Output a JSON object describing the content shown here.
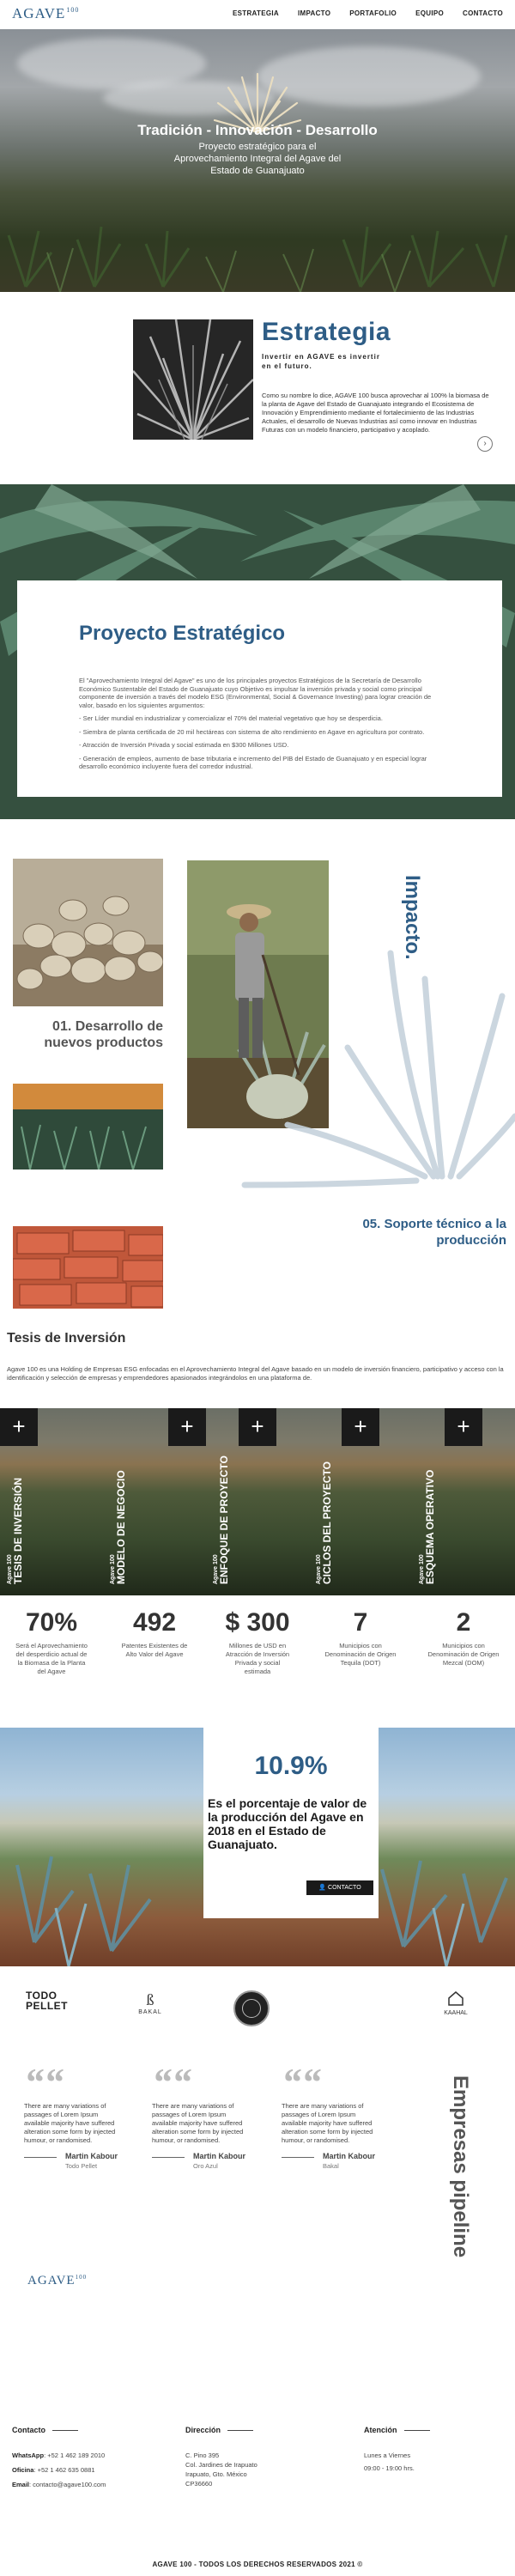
{
  "header": {
    "logo": "AGAVE",
    "logo_num": "100",
    "nav": [
      "ESTRATEGIA",
      "IMPACTO",
      "PORTAFOLIO",
      "EQUIPO",
      "CONTACTO"
    ]
  },
  "hero": {
    "title": "Tradición - Innovación - Desarrollo",
    "subtitle": "Proyecto estratégico para el Aprovechamiento Integral del Agave del Estado de Guanajuato"
  },
  "estrategia": {
    "title": "Estrategia",
    "tagline": "Invertir en AGAVE es invertir en el futuro.",
    "body": "Como su nombre lo dice, AGAVE 100 busca aprovechar al 100% la biomasa de la planta de Agave del Estado de Guanajuato integrando el Ecosistema de Innovación y Emprendimiento mediante el fortalecimiento de las Industrias Actuales, el desarrollo de Nuevas Industrias así como innovar en Industrias Futuras con un modelo financiero, participativo y acoplado.",
    "next_glyph": "›"
  },
  "proyecto": {
    "title": "Proyecto Estratégico",
    "items": [
      "El \"Aprovechamiento Integral del Agave\" es uno de los principales proyectos Estratégicos de la Secretaría de Desarrollo Económico Sustentable del Estado de Guanajuato cuyo Objetivo es impulsar la inversión privada y social como principal componente de inversión a través del modelo ESG (Environmental, Social & Governance Investing) para lograr creación de valor, basado en los siguientes argumentos:",
      "- Ser Líder mundial en industrializar y comercializar el 70% del material vegetativo que hoy se desperdicia.",
      "- Siembra de planta certificada de 20 mil hectáreas con sistema de alto rendimiento en Agave en agricultura por contrato.",
      "- Atracción de Inversión Privada y social estimada en $300 Millones USD.",
      "- Generación de empleos, aumento de base tributaria e incremento del PIB del Estado de Guanajuato y en especial lograr desarrollo económico incluyente fuera del corredor industrial."
    ]
  },
  "impacto": {
    "title": "Impacto.",
    "item1": "01. Desarrollo de nuevos productos",
    "item5": "05. Soporte técnico a la producción"
  },
  "tesis": {
    "title": "Tesis de Inversión",
    "body": "Agave 100 es una Holding de Empresas ESG enfocadas en el Aprovechamiento Integral del Agave basado en un modelo de inversión financiero, participativo y acceso con la identificación y selección de empresas y emprendedores apasionados integrándolos en una plataforma de.",
    "panels": [
      {
        "small": "Agave 100",
        "big": "TESIS DE INVERSIÓN"
      },
      {
        "small": "Agave 100",
        "big": "MODELO DE NEGOCIO"
      },
      {
        "small": "Agave 100",
        "big": "ENFOQUE DE PROYECTO"
      },
      {
        "small": "Agave 100",
        "big": "CICLOS DEL PROYECTO"
      },
      {
        "small": "Agave 100",
        "big": "ESQUEMA OPERATIVO"
      }
    ],
    "plus": "+"
  },
  "stats": [
    {
      "num": "70%",
      "label": "Será el Aprovechamiento del desperdicio actual de la Biomasa de la Planta del Agave"
    },
    {
      "num": "492",
      "label": "Patentes Existentes de Alto Valor del Agave"
    },
    {
      "num": "$ 300",
      "label": "Millones de USD en Atracción de Inversión Privada y social estimada"
    },
    {
      "num": "7",
      "label": "Municipios con Denominación de Origen Tequila (DOT)"
    },
    {
      "num": "2",
      "label": "Municipios con Denominación de Origen Mezcal (DOM)"
    }
  ],
  "highlight": {
    "number": "10.9%",
    "text": "Es el porcentaje de valor de la producción del Agave en 2018 en el Estado de Guanajuato.",
    "button": "CONTACTO"
  },
  "partners": {
    "p1": "TODO PELLET",
    "p2": "BAKAL",
    "p3": "",
    "p4": "KAAHAL"
  },
  "testimonials": [
    {
      "text": "There are many variations of passages of Lorem Ipsum available majority have suffered alteration some form by injected humour, or randomised.",
      "name": "Martin Kabour",
      "company": "Todo Pellet"
    },
    {
      "text": "There are many variations of passages of Lorem Ipsum available majority have suffered alteration some form by injected humour, or randomised.",
      "name": "Martin Kabour",
      "company": "Oro Azul"
    },
    {
      "text": "There are many variations of passages of Lorem Ipsum available majority have suffered alteration some form by injected humour, or randomised.",
      "name": "Martin Kabour",
      "company": "Bakal"
    }
  ],
  "pipeline_title": "Empresas pipeline",
  "quote_glyph": "““",
  "footer": {
    "contacto": {
      "head": "Contacto",
      "whatsapp_label": "WhatsApp",
      "whatsapp": ": +52 1 462 189 2010",
      "oficina_label": "Oficina",
      "oficina": ": +52 1 462 635 0881",
      "email_label": "Email",
      "email": ": contacto@agave100.com"
    },
    "direccion": {
      "head": "Dirección",
      "lines": [
        "C. Pino 395",
        "Col. Jardines de Irapuato",
        "Irapuato, Gto. México",
        "CP36660"
      ]
    },
    "atencion": {
      "head": "Atención",
      "lines": [
        "Lunes a Viernes",
        "09:00 - 19:00 hrs."
      ]
    },
    "copyright": "AGAVE 100 - TODOS LOS DERECHOS RESERVADOS 2021 ©"
  }
}
